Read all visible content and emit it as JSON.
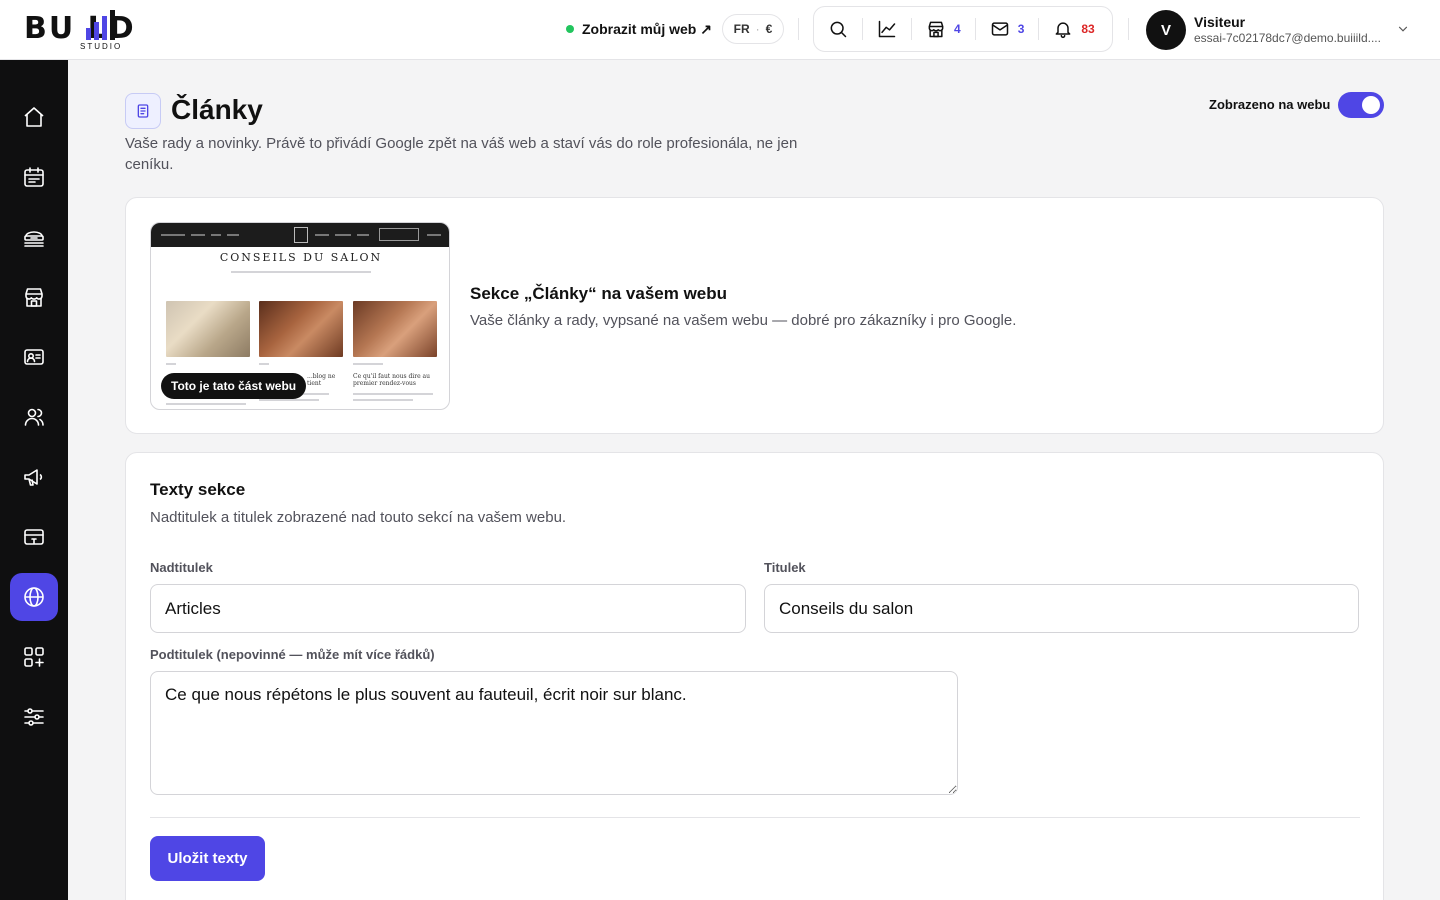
{
  "brand": {
    "logo_text": "BU  LD",
    "logo_sub": "STUDIO",
    "accent": "#4f46e5"
  },
  "header": {
    "view_site_label": "Zobrazit můj web ↗",
    "language": "FR",
    "currency": "€",
    "tools": [
      {
        "icon": "search-icon"
      },
      {
        "icon": "chart-icon"
      },
      {
        "icon": "store-icon",
        "count": "4"
      },
      {
        "icon": "mail-icon",
        "count": "3"
      },
      {
        "icon": "bell-icon",
        "count": "83"
      }
    ],
    "user": {
      "initial": "V",
      "name": "Visiteur",
      "email": "essai-7c02178dc7@demo.buiiild...."
    }
  },
  "sidebar": {
    "items": [
      {
        "icon": "home-icon"
      },
      {
        "icon": "calendar-icon"
      },
      {
        "icon": "services-icon"
      },
      {
        "icon": "store-icon"
      },
      {
        "icon": "id-card-icon"
      },
      {
        "icon": "users-icon"
      },
      {
        "icon": "megaphone-icon"
      },
      {
        "icon": "gift-card-icon"
      },
      {
        "icon": "globe-icon",
        "active": true
      },
      {
        "icon": "apps-add-icon"
      },
      {
        "icon": "settings-sliders-icon"
      }
    ]
  },
  "page": {
    "title": "Články",
    "description": "Vaše rady a novinky. Právě to přivádí Google zpět na váš web a staví vás do role profesionála, ne jen ceníku.",
    "visibility_label": "Zobrazeno na webu",
    "visible": true
  },
  "section_card": {
    "preview_heading": "CONSEILS DU SALON",
    "preview_caption_2": "...blog ne tient",
    "preview_caption_3": "Ce qu'il faut nous dire au premier rendez-vous",
    "preview_badge": "Toto je tato část webu",
    "title": "Sekce „Články“ na vašem webu",
    "description": "Vaše články a rady, vypsané na vašem webu — dobré pro zákazníky i pro Google."
  },
  "texts_card": {
    "title": "Texty sekce",
    "description": "Nadtitulek a titulek zobrazené nad touto sekcí na vašem webu.",
    "overline_label": "Nadtitulek",
    "overline_value": "Articles",
    "title_label": "Titulek",
    "title_value": "Conseils du salon",
    "subtitle_label": "Podtitulek (nepovinné — může mít více řádků)",
    "subtitle_value": "Ce que nous répétons le plus souvent au fauteuil, écrit noir sur blanc.",
    "save_label": "Uložit texty"
  }
}
